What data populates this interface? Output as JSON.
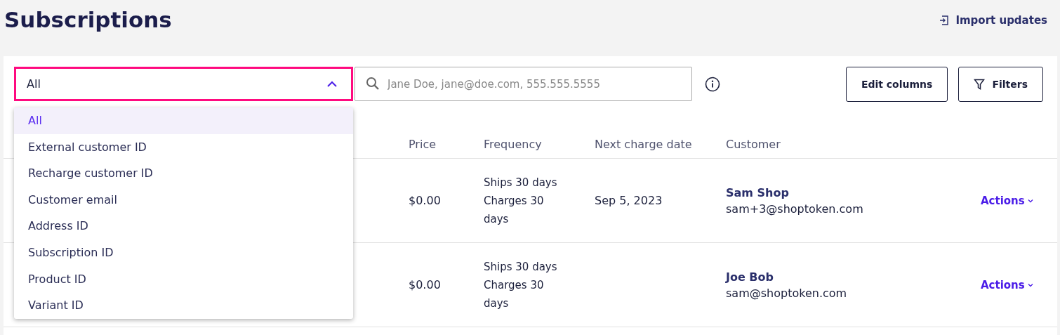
{
  "page": {
    "title": "Subscriptions",
    "import_link": "Import updates"
  },
  "toolbar": {
    "search_type": {
      "value": "All",
      "expanded": true
    },
    "search": {
      "placeholder": "Jane Doe, jane@doe.com, 555.555.5555"
    },
    "buttons": [
      {
        "label": "Edit columns",
        "kind": "plain"
      },
      {
        "label": "Filters",
        "kind": "filter"
      }
    ]
  },
  "search_type_menu": [
    {
      "label": "All",
      "selected": true
    },
    {
      "label": "External customer ID",
      "selected": false
    },
    {
      "label": "Recharge customer ID",
      "selected": false
    },
    {
      "label": "Customer email",
      "selected": false
    },
    {
      "label": "Address ID",
      "selected": false
    },
    {
      "label": "Subscription ID",
      "selected": false
    },
    {
      "label": "Product ID",
      "selected": false
    },
    {
      "label": "Variant ID",
      "selected": false
    }
  ],
  "table": {
    "columns": [
      "Price",
      "Frequency",
      "Next charge date",
      "Customer"
    ],
    "rows": [
      {
        "price": "$0.00",
        "frequency": "Ships 30 days Charges 30 days",
        "next_charge_date": "Sep 5, 2023",
        "customer_name": "Sam Shop",
        "customer_email": "sam+3@shoptoken.com",
        "action": "Actions"
      },
      {
        "price": "$0.00",
        "frequency": "Ships 30 days Charges 30 days",
        "customer_name": "Joe Bob",
        "customer_email": "sam@shoptoken.com",
        "action": "Actions"
      }
    ]
  }
}
